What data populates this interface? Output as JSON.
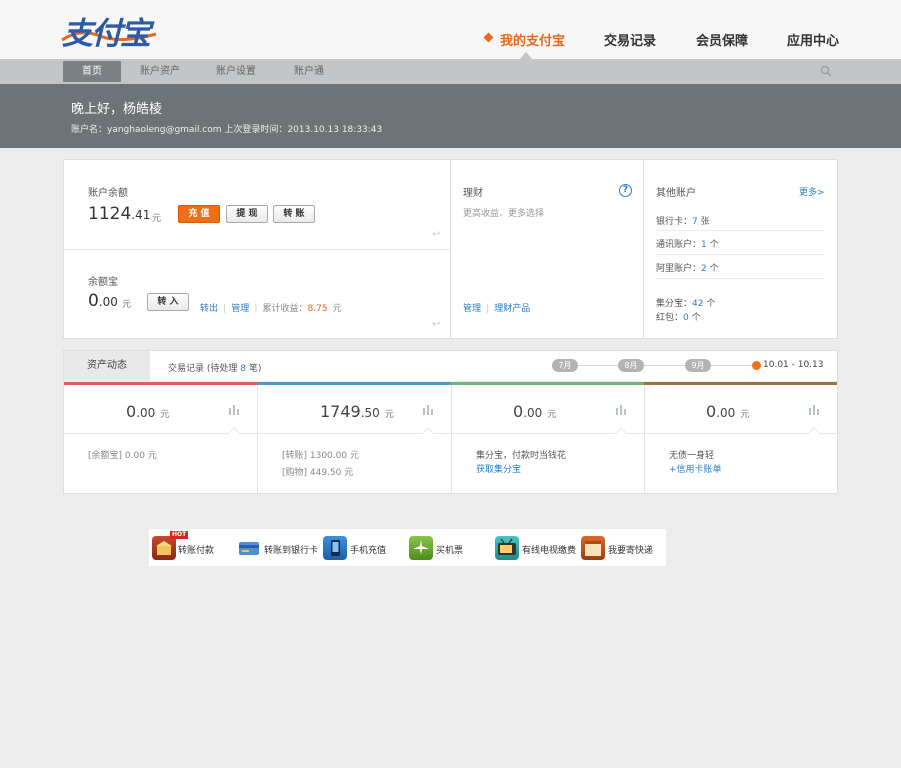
{
  "header": {
    "logo_text": "支付宝",
    "nav": [
      "我的支付宝",
      "交易记录",
      "会员保障",
      "应用中心"
    ]
  },
  "subnav": [
    "首页",
    "账户资产",
    "账户设置",
    "账户通"
  ],
  "greeting": {
    "title": "晚上好，杨皓棱",
    "account_label": "账户名：",
    "account": "yanghaoleng@gmail.com",
    "last_login_label": "上次登录时间：",
    "last_login": "2013.10.13 18:33:43"
  },
  "balance": {
    "label": "账户余额",
    "int": "1124",
    "dec": ".41",
    "unit": "元",
    "recharge": "充 值",
    "withdraw": "提 现",
    "transfer": "转 账"
  },
  "yuebao": {
    "label": "余额宝",
    "int": "0",
    "dec": ".00",
    "unit": "元",
    "transfer_in": "转 入",
    "out": "转出",
    "manage": "管理",
    "earn_label": "累计收益：",
    "earn": "8.75",
    "earn_unit": "元"
  },
  "licai": {
    "title": "理财",
    "sub": "更高收益、更多选择",
    "manage": "管理",
    "products": "理财产品"
  },
  "other": {
    "title": "其他账户",
    "more": "更多>",
    "bank_label": "银行卡：",
    "bank_val": "7",
    "bank_unit": "张",
    "tongxun_label": "通讯账户：",
    "tongxun_val": "1",
    "tongxun_unit": "个",
    "ali_label": "阿里账户：",
    "ali_val": "2",
    "ali_unit": "个",
    "jifen_label": "集分宝：",
    "jifen_val": "42",
    "jifen_unit": "个",
    "hongbao_label": "红包：",
    "hongbao_val": "0",
    "hongbao_unit": "个"
  },
  "dynamics": {
    "tab_active": "资产动态",
    "tab_records": "交易记录 (待处理",
    "pending": "8",
    "tab_records_end": "笔)",
    "months": [
      "7月",
      "8月",
      "9月"
    ],
    "range": "10.01 - 10.13",
    "cols": [
      {
        "int": "0",
        "dec": ".00",
        "unit": "元"
      },
      {
        "int": "1749",
        "dec": ".50",
        "unit": "元"
      },
      {
        "int": "0",
        "dec": ".00",
        "unit": "元"
      },
      {
        "int": "0",
        "dec": ".00",
        "unit": "元"
      }
    ],
    "col1_detail": "[余额宝] 0.00 元",
    "col2_detail1": "[转账] 1300.00 元",
    "col2_detail2": "[购物] 449.50 元",
    "col3_detail": "集分宝，付款时当钱花",
    "col3_link": "获取集分宝",
    "col4_detail": "无债一身轻",
    "col4_link": "+信用卡账单"
  },
  "colors": {
    "accent": "#f06f14",
    "bar1": "#d9625f",
    "bar2": "#4b9bd0",
    "bar3": "#6fb778",
    "bar4": "#9a7442"
  },
  "services": {
    "hot": "HOT",
    "items": [
      "转账付款",
      "转账到银行卡",
      "手机充值",
      "买机票",
      "有线电视缴费",
      "我要寄快递"
    ]
  }
}
